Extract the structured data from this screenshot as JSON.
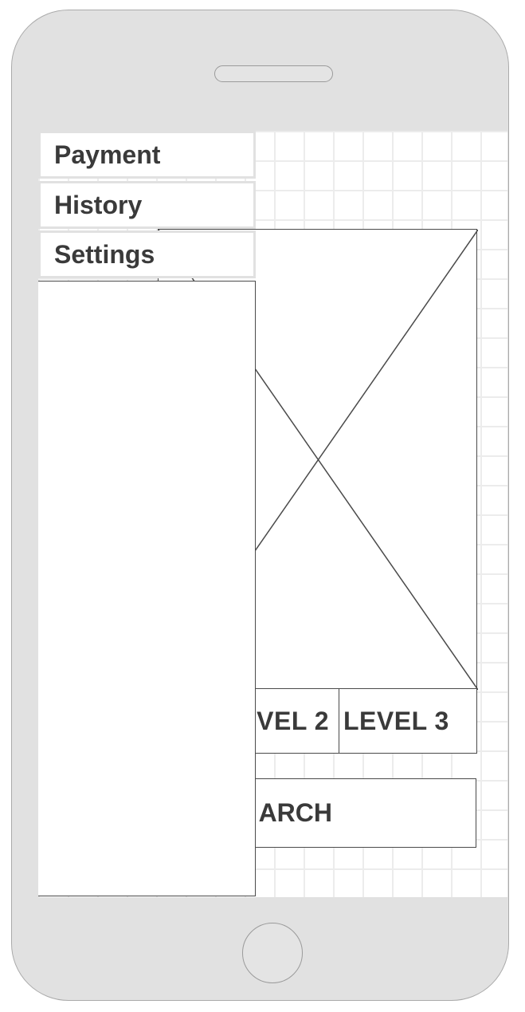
{
  "menu": {
    "items": [
      {
        "label": "Payment"
      },
      {
        "label": "History"
      },
      {
        "label": "Settings"
      }
    ]
  },
  "tabs": {
    "level2_label": "VEL 2",
    "level3_label": "LEVEL 3"
  },
  "search": {
    "label": "ARCH"
  },
  "colors": {
    "device_frame": "#e1e1e1",
    "grid_line": "#ececec",
    "wireframe_stroke": "#4a4a4a",
    "text": "#3a3a3a"
  }
}
